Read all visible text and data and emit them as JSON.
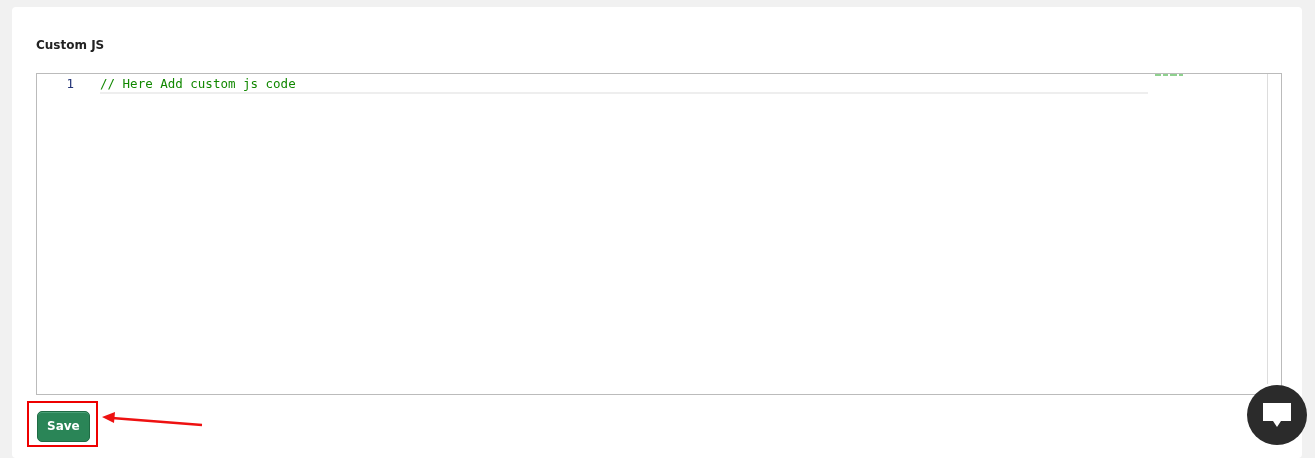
{
  "section": {
    "title": "Custom JS"
  },
  "editor": {
    "lines": [
      {
        "number": "1",
        "code": "// Here Add custom js code",
        "current": true
      }
    ]
  },
  "save_button": {
    "label": "Save",
    "annotated": true
  }
}
